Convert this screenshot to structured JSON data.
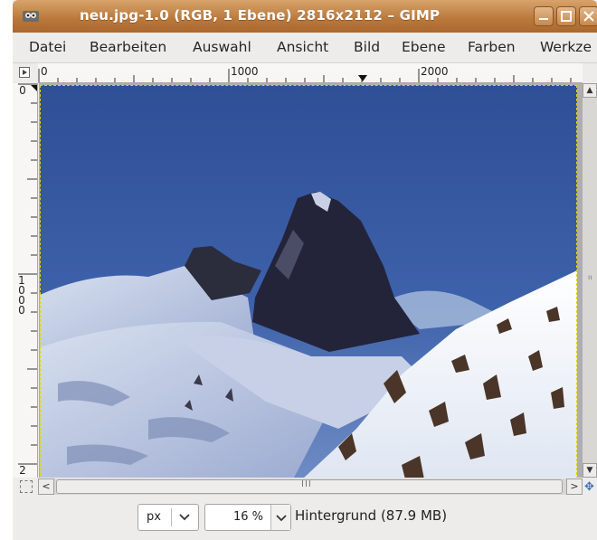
{
  "window": {
    "title": "neu.jpg-1.0 (RGB, 1 Ebene) 2816x2112 – GIMP"
  },
  "menu": {
    "items": [
      "Datei",
      "Bearbeiten",
      "Auswahl",
      "Ansicht",
      "Bild",
      "Ebene",
      "Farben",
      "Werkze"
    ]
  },
  "rulers": {
    "horizontal_labels": [
      "0",
      "1000",
      "2000"
    ],
    "vertical_labels": [
      "0",
      "1000",
      "2"
    ]
  },
  "scroll": {
    "h_grip": "III",
    "v_grip": "ıı",
    "left_arrow": "<",
    "right_arrow": ">"
  },
  "status": {
    "unit": "px",
    "zoom": "16 %",
    "layer_info": "Hintergrund (87.9 MB)"
  },
  "colors": {
    "titlebar": "#b9773a",
    "selection_border": "#e8d000",
    "sky": "#3b5fa6"
  },
  "icons": [
    "gimp-app-icon",
    "minimize-icon",
    "maximize-icon",
    "close-icon",
    "quick-mask-icon",
    "navigate-icon",
    "chevron-down-icon"
  ]
}
